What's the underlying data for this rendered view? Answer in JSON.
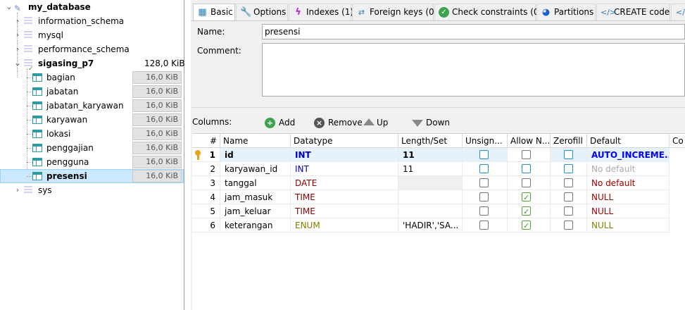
{
  "tree": {
    "root": "my_database",
    "databases": [
      {
        "name": "information_schema"
      },
      {
        "name": "mysql"
      },
      {
        "name": "performance_schema"
      },
      {
        "name": "sigasing_p7",
        "size": "128,0 KiB"
      }
    ],
    "tables": [
      {
        "name": "bagian",
        "size": "16,0 KiB"
      },
      {
        "name": "jabatan",
        "size": "16,0 KiB"
      },
      {
        "name": "jabatan_karyawan",
        "size": "16,0 KiB"
      },
      {
        "name": "karyawan",
        "size": "16,0 KiB"
      },
      {
        "name": "lokasi",
        "size": "16,0 KiB"
      },
      {
        "name": "penggajian",
        "size": "16,0 KiB"
      },
      {
        "name": "pengguna",
        "size": "16,0 KiB"
      },
      {
        "name": "presensi",
        "size": "16,0 KiB"
      }
    ],
    "last_db": "sys"
  },
  "tabs": [
    "Basic",
    "Options",
    "Indexes (1)",
    "Foreign keys (0)",
    "Check constraints (0)",
    "Partitions",
    "CREATE code"
  ],
  "form": {
    "name_label": "Name:",
    "name_value": "presensi",
    "comment_label": "Comment:"
  },
  "columns_bar": {
    "label": "Columns:",
    "add": "Add",
    "remove": "Remove",
    "up": "Up",
    "down": "Down"
  },
  "grid": {
    "headers": [
      "#",
      "Name",
      "Datatype",
      "Length/Set",
      "Unsign...",
      "Allow N...",
      "Zerofill",
      "Default",
      "Co"
    ],
    "rows": [
      {
        "num": "1",
        "name": "id",
        "type": "INT",
        "length": "11",
        "default": "AUTO_INCREME..."
      },
      {
        "num": "2",
        "name": "karyawan_id",
        "type": "INT",
        "length": "11",
        "default": "No default"
      },
      {
        "num": "3",
        "name": "tanggal",
        "type": "DATE",
        "length": "",
        "default": "No default"
      },
      {
        "num": "4",
        "name": "jam_masuk",
        "type": "TIME",
        "length": "",
        "default": "NULL"
      },
      {
        "num": "5",
        "name": "jam_keluar",
        "type": "TIME",
        "length": "",
        "default": "NULL"
      },
      {
        "num": "6",
        "name": "keterangan",
        "type": "ENUM",
        "length": "'HADIR','SA...",
        "default": "NULL"
      }
    ]
  },
  "colors": {
    "int_type": "#0000c0",
    "date_type": "#8b0000",
    "enum_type": "#808000",
    "default_null": "#a00000",
    "auto_increment": "#0000ff",
    "selection": "#cce8ff"
  }
}
